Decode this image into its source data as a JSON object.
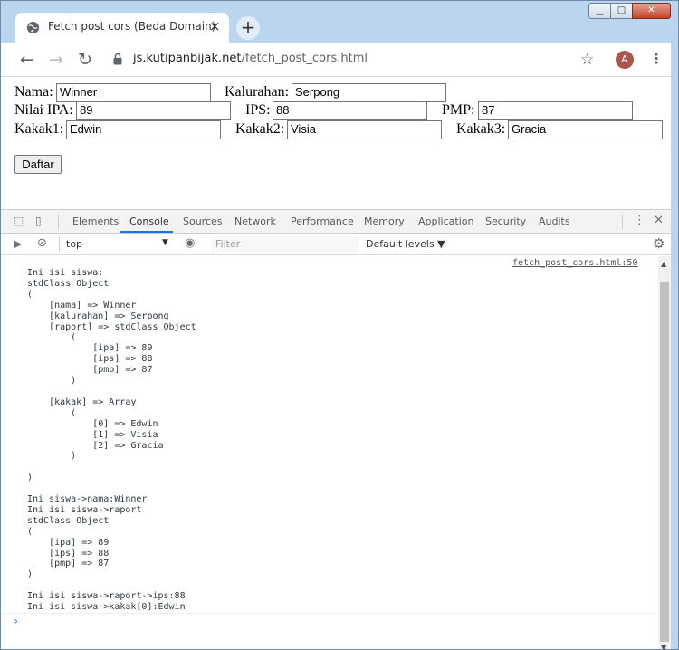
{
  "browser": {
    "tab_title": "Fetch post cors (Beda Domain)",
    "tab_close": "×",
    "new_tab": "+",
    "url_host": "js.kutipanbijak.net",
    "url_path": "/fetch_post_cors.html",
    "avatar_letter": "A",
    "window_buttons": {
      "minimize": "▁",
      "maximize": "□",
      "close": "✕"
    }
  },
  "form": {
    "nama_label": "Nama:",
    "nama_value": "Winner",
    "kalurahan_label": "Kalurahan:",
    "kalurahan_value": "Serpong",
    "ipa_label": "Nilai IPA:",
    "ipa_value": "89",
    "ips_label": "IPS:",
    "ips_value": "88",
    "pmp_label": "PMP:",
    "pmp_value": "87",
    "kakak1_label": "Kakak1:",
    "kakak1_value": "Edwin",
    "kakak2_label": "Kakak2:",
    "kakak2_value": "Visia",
    "kakak3_label": "Kakak3:",
    "kakak3_value": "Gracia",
    "submit_label": "Daftar"
  },
  "devtools": {
    "tabs": [
      "Elements",
      "Console",
      "Sources",
      "Network",
      "Performance",
      "Memory",
      "Application",
      "Security",
      "Audits"
    ],
    "active_tab": "Console",
    "context": "top",
    "filter_placeholder": "Filter",
    "levels": "Default levels ▼",
    "source_link": "fetch_post_cors.html:50",
    "accent_color": "#1a73e8",
    "console_output": "Ini isi siswa:\nstdClass Object\n(\n    [nama] => Winner\n    [kalurahan] => Serpong\n    [raport] => stdClass Object\n        (\n            [ipa] => 89\n            [ips] => 88\n            [pmp] => 87\n        )\n\n    [kakak] => Array\n        (\n            [0] => Edwin\n            [1] => Visia\n            [2] => Gracia\n        )\n\n)\n\nIni siswa->nama:Winner\nIni isi siswa->raport\nstdClass Object\n(\n    [ipa] => 89\n    [ips] => 88\n    [pmp] => 87\n)\n\nIni isi siswa->raport->ips:88\nIni isi siswa->kakak[0]:Edwin",
    "prompt": "›"
  }
}
